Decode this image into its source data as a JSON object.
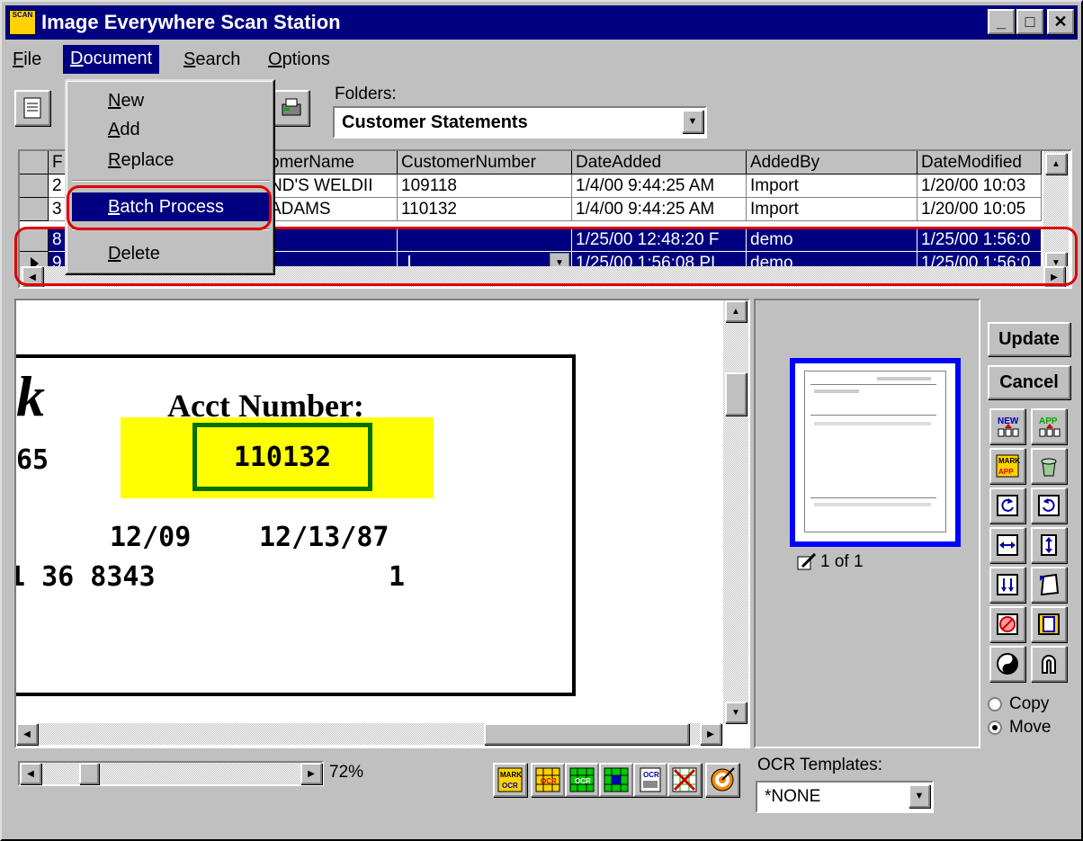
{
  "window": {
    "title": "Image Everywhere Scan Station",
    "app_icon_text": "SCAN",
    "minimize": "_",
    "maximize": "□",
    "close": "✕"
  },
  "menubar": {
    "file": "File",
    "document": "Document",
    "search": "Search",
    "options": "Options"
  },
  "toolbar": {
    "folders_label": "Folders:",
    "folders_value": "Customer Statements"
  },
  "document_menu": {
    "items": [
      "New",
      "Add",
      "Replace",
      "Batch Process",
      "Delete"
    ],
    "highlighted": "Batch Process"
  },
  "grid": {
    "columns": [
      "F",
      "omerName",
      "CustomerNumber",
      "DateAdded",
      "AddedBy",
      "DateModified"
    ],
    "rows": [
      {
        "first": "2",
        "name": "ND'S WELDII",
        "number": "109118",
        "added": "1/4/00 9:44:25 AM",
        "by": "Import",
        "modified": "1/20/00 10:03"
      },
      {
        "first": "3",
        "name": "ADAMS",
        "number": "110132",
        "added": "1/4/00 9:44:25 AM",
        "by": "Import",
        "modified": "1/20/00 10:05"
      },
      {
        "first": "8",
        "name": "",
        "number": "",
        "added": "1/25/00 12:48:20 F",
        "by": "demo",
        "modified": "1/25/00 1:56:0"
      },
      {
        "first": "9",
        "name": "",
        "number": "",
        "added": "1/25/00 1:56:08 PI",
        "by": "demo",
        "modified": "1/25/00 1:56:0"
      }
    ]
  },
  "document_image": {
    "big_letter": "k",
    "acct_label": "Acct Number:",
    "acct_value": "110132",
    "line1_left": "65",
    "line2_a": "12/09",
    "line2_b": "12/13/87",
    "line3_a": "1 36 8343",
    "line3_b": "1"
  },
  "thumbnail": {
    "page_indicator": "1 of 1"
  },
  "side_buttons": {
    "update": "Update",
    "cancel": "Cancel",
    "icons": [
      "new-icon",
      "append-icon",
      "mark-append-icon",
      "recycle-icon",
      "rotate-left-icon",
      "rotate-right-icon",
      "fit-width-icon",
      "fit-height-icon",
      "flip-icon",
      "deskew-icon",
      "despeckle-icon",
      "crop-icon",
      "invert-icon",
      "magnet-icon"
    ],
    "copy_label": "Copy",
    "move_label": "Move",
    "selected_mode": "Move"
  },
  "bottom": {
    "zoom": "72%",
    "ocr_label": "OCR Templates:",
    "ocr_value": "*NONE",
    "ocr_icons": [
      "mark-ocr-icon",
      "ocr-grid-icon",
      "ocr-green-icon",
      "ocr-table-icon",
      "ocr-page-icon",
      "ocr-clear-icon",
      "target-icon"
    ]
  },
  "colors": {
    "title_bar": "#000080",
    "selection": "#000080",
    "highlight_box": "#ffff00",
    "acct_box_border": "#007000",
    "annotation": "#e00000",
    "thumbnail_border": "#0000ff"
  }
}
